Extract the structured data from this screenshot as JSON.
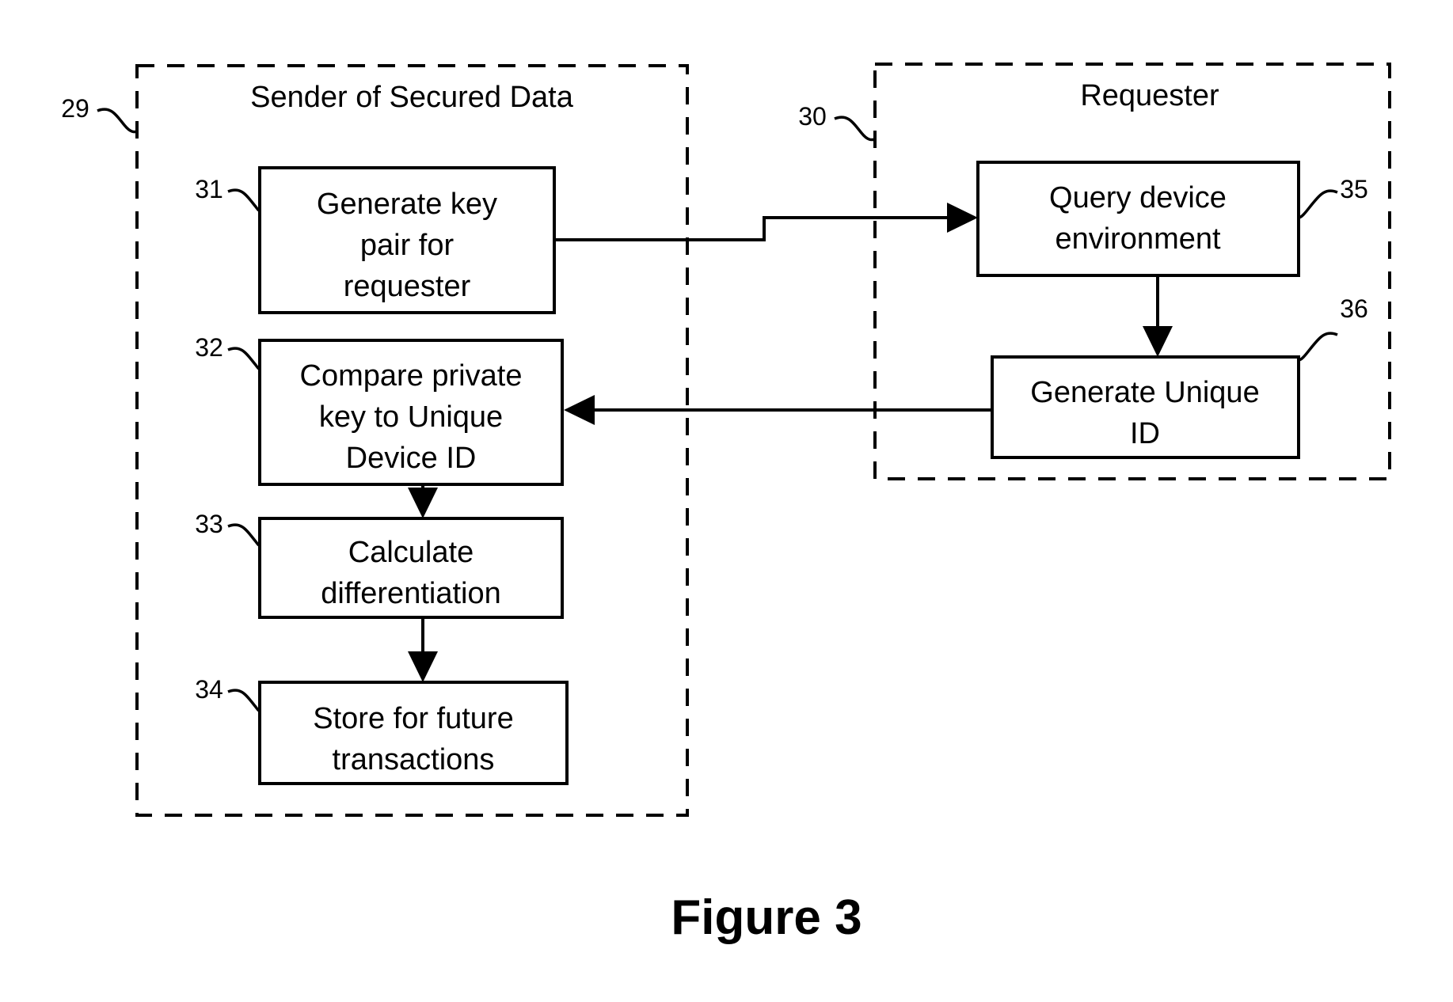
{
  "figure": {
    "caption": "Figure 3"
  },
  "groups": [
    {
      "id": "sender",
      "title": "Sender of Secured Data",
      "ref": "29"
    },
    {
      "id": "requester",
      "title": "Requester",
      "ref": "30"
    }
  ],
  "boxes": [
    {
      "id": "generate-key-pair",
      "ref": "31",
      "lines": [
        "Generate key",
        "pair for",
        "requester"
      ]
    },
    {
      "id": "compare-private-key",
      "ref": "32",
      "lines": [
        "Compare private",
        "key to Unique",
        "Device ID"
      ]
    },
    {
      "id": "calculate-differentiation",
      "ref": "33",
      "lines": [
        "Calculate",
        "differentiation"
      ]
    },
    {
      "id": "store-for-future",
      "ref": "34",
      "lines": [
        "Store for future",
        "transactions"
      ]
    },
    {
      "id": "query-device-environment",
      "ref": "35",
      "lines": [
        "Query device",
        "environment"
      ]
    },
    {
      "id": "generate-unique-id",
      "ref": "36",
      "lines": [
        "Generate Unique",
        "ID"
      ]
    }
  ],
  "colors": {
    "ink": "#000000",
    "paper": "#ffffff"
  }
}
